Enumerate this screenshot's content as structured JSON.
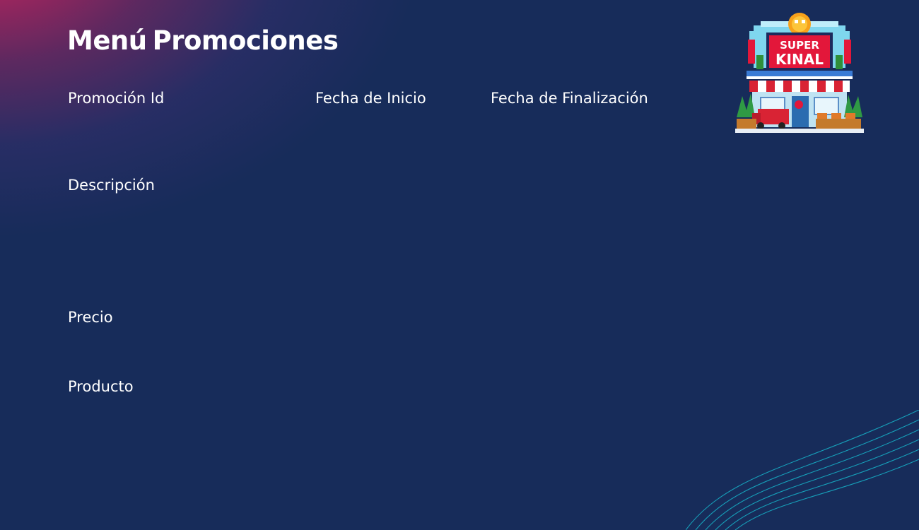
{
  "header": {
    "title_word_1": "Menú",
    "title_word_2": "Promociones"
  },
  "logo": {
    "line_1": "SUPER",
    "line_2": "KINAL",
    "icon": "store-logo-icon",
    "colors": {
      "sign_red": "#e3173a",
      "awning_red": "#d92334",
      "sky_blue": "#7fd6ee",
      "sun_orange": "#f7a11a"
    }
  },
  "form": {
    "labels": {
      "promocion_id": "Promoción Id",
      "fecha_inicio": "Fecha de Inicio",
      "fecha_finalizacion": "Fecha de Finalización",
      "descripcion": "Descripción",
      "precio": "Precio",
      "producto": "Producto"
    }
  },
  "theme": {
    "background": "#172c5a",
    "accent_magenta": "#d6225c",
    "wave_cyan": "#17b3c9"
  }
}
